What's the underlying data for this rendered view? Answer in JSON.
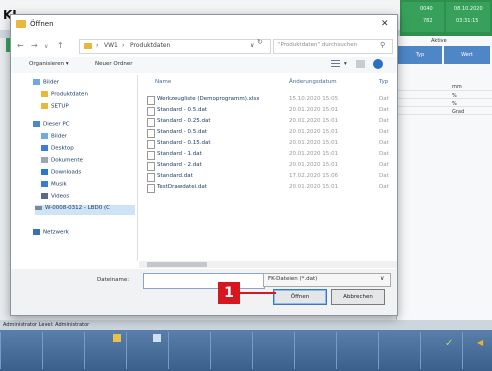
{
  "app": {
    "logo": "KI",
    "green_texts": [
      "0040",
      "08.10.2020",
      "782",
      "03:31:15"
    ],
    "grid_headers": [
      "Aktive",
      "Typ",
      "Wert"
    ],
    "grid_cells": [
      "mm",
      "%",
      "%",
      "Grad"
    ],
    "status_text": "Administrator  Level: Administrator"
  },
  "dialog": {
    "title": "Öffnen",
    "address": [
      "VW1",
      "Produktdaten"
    ],
    "search_placeholder": "\"Produktdaten\" durchsuchen",
    "commands": {
      "organize": "Organisieren ▾",
      "new_folder": "Neuer Ordner"
    },
    "nav_items": [
      {
        "label": "Bilder",
        "icon": "pictures-icon"
      },
      {
        "label": "Produktdaten",
        "icon": "folder-icon"
      },
      {
        "label": "SETUP",
        "icon": "folder-icon"
      },
      {
        "label": "Dieser PC",
        "icon": "computer-icon"
      },
      {
        "label": "Bilder",
        "icon": "pictures-icon"
      },
      {
        "label": "Desktop",
        "icon": "desktop-icon"
      },
      {
        "label": "Dokumente",
        "icon": "documents-icon"
      },
      {
        "label": "Downloads",
        "icon": "download-icon"
      },
      {
        "label": "Musik",
        "icon": "music-icon"
      },
      {
        "label": "Videos",
        "icon": "video-icon"
      },
      {
        "label": "W-0008-0312 - LBD0 (C",
        "icon": "drive-icon"
      },
      {
        "label": "Netzwerk",
        "icon": "network-icon"
      }
    ],
    "columns": {
      "name": "Name",
      "date": "Änderungsdatum",
      "type": "Typ"
    },
    "files": [
      {
        "name": "Werkzeugliste (Demoprogramm).xlsx",
        "date": "15.10.2020 15:05",
        "type": "Dat"
      },
      {
        "name": "Standard - 0.5.dat",
        "date": "20.01.2020 15:01",
        "type": "Dat"
      },
      {
        "name": "Standard - 0.25.dat",
        "date": "20.01.2020 15:01",
        "type": "Dat"
      },
      {
        "name": "Standard - 0.5.dat",
        "date": "20.01.2020 15:01",
        "type": "Dat"
      },
      {
        "name": "Standard - 0.15.dat",
        "date": "20.01.2020 15:01",
        "type": "Dat"
      },
      {
        "name": "Standard - 1.dat",
        "date": "20.01.2020 15:01",
        "type": "Dat"
      },
      {
        "name": "Standard - 2.dat",
        "date": "20.01.2020 15:01",
        "type": "Dat"
      },
      {
        "name": "Standard.dat",
        "date": "17.02.2020 15:06",
        "type": "Dat"
      },
      {
        "name": "TestDrawdatei.dat",
        "date": "20.01.2020 15:01",
        "type": "Dat"
      }
    ],
    "filename_label": "Dateiname:",
    "filename_value": "",
    "filter_value": "FK-Dateien (*.dat)",
    "open_label": "Öffnen",
    "cancel_label": "Abbrechen"
  },
  "callout_number": "1",
  "colors": {
    "accent": "#3a78c6",
    "callout": "#d6171f",
    "green": "#2f8f4e"
  }
}
